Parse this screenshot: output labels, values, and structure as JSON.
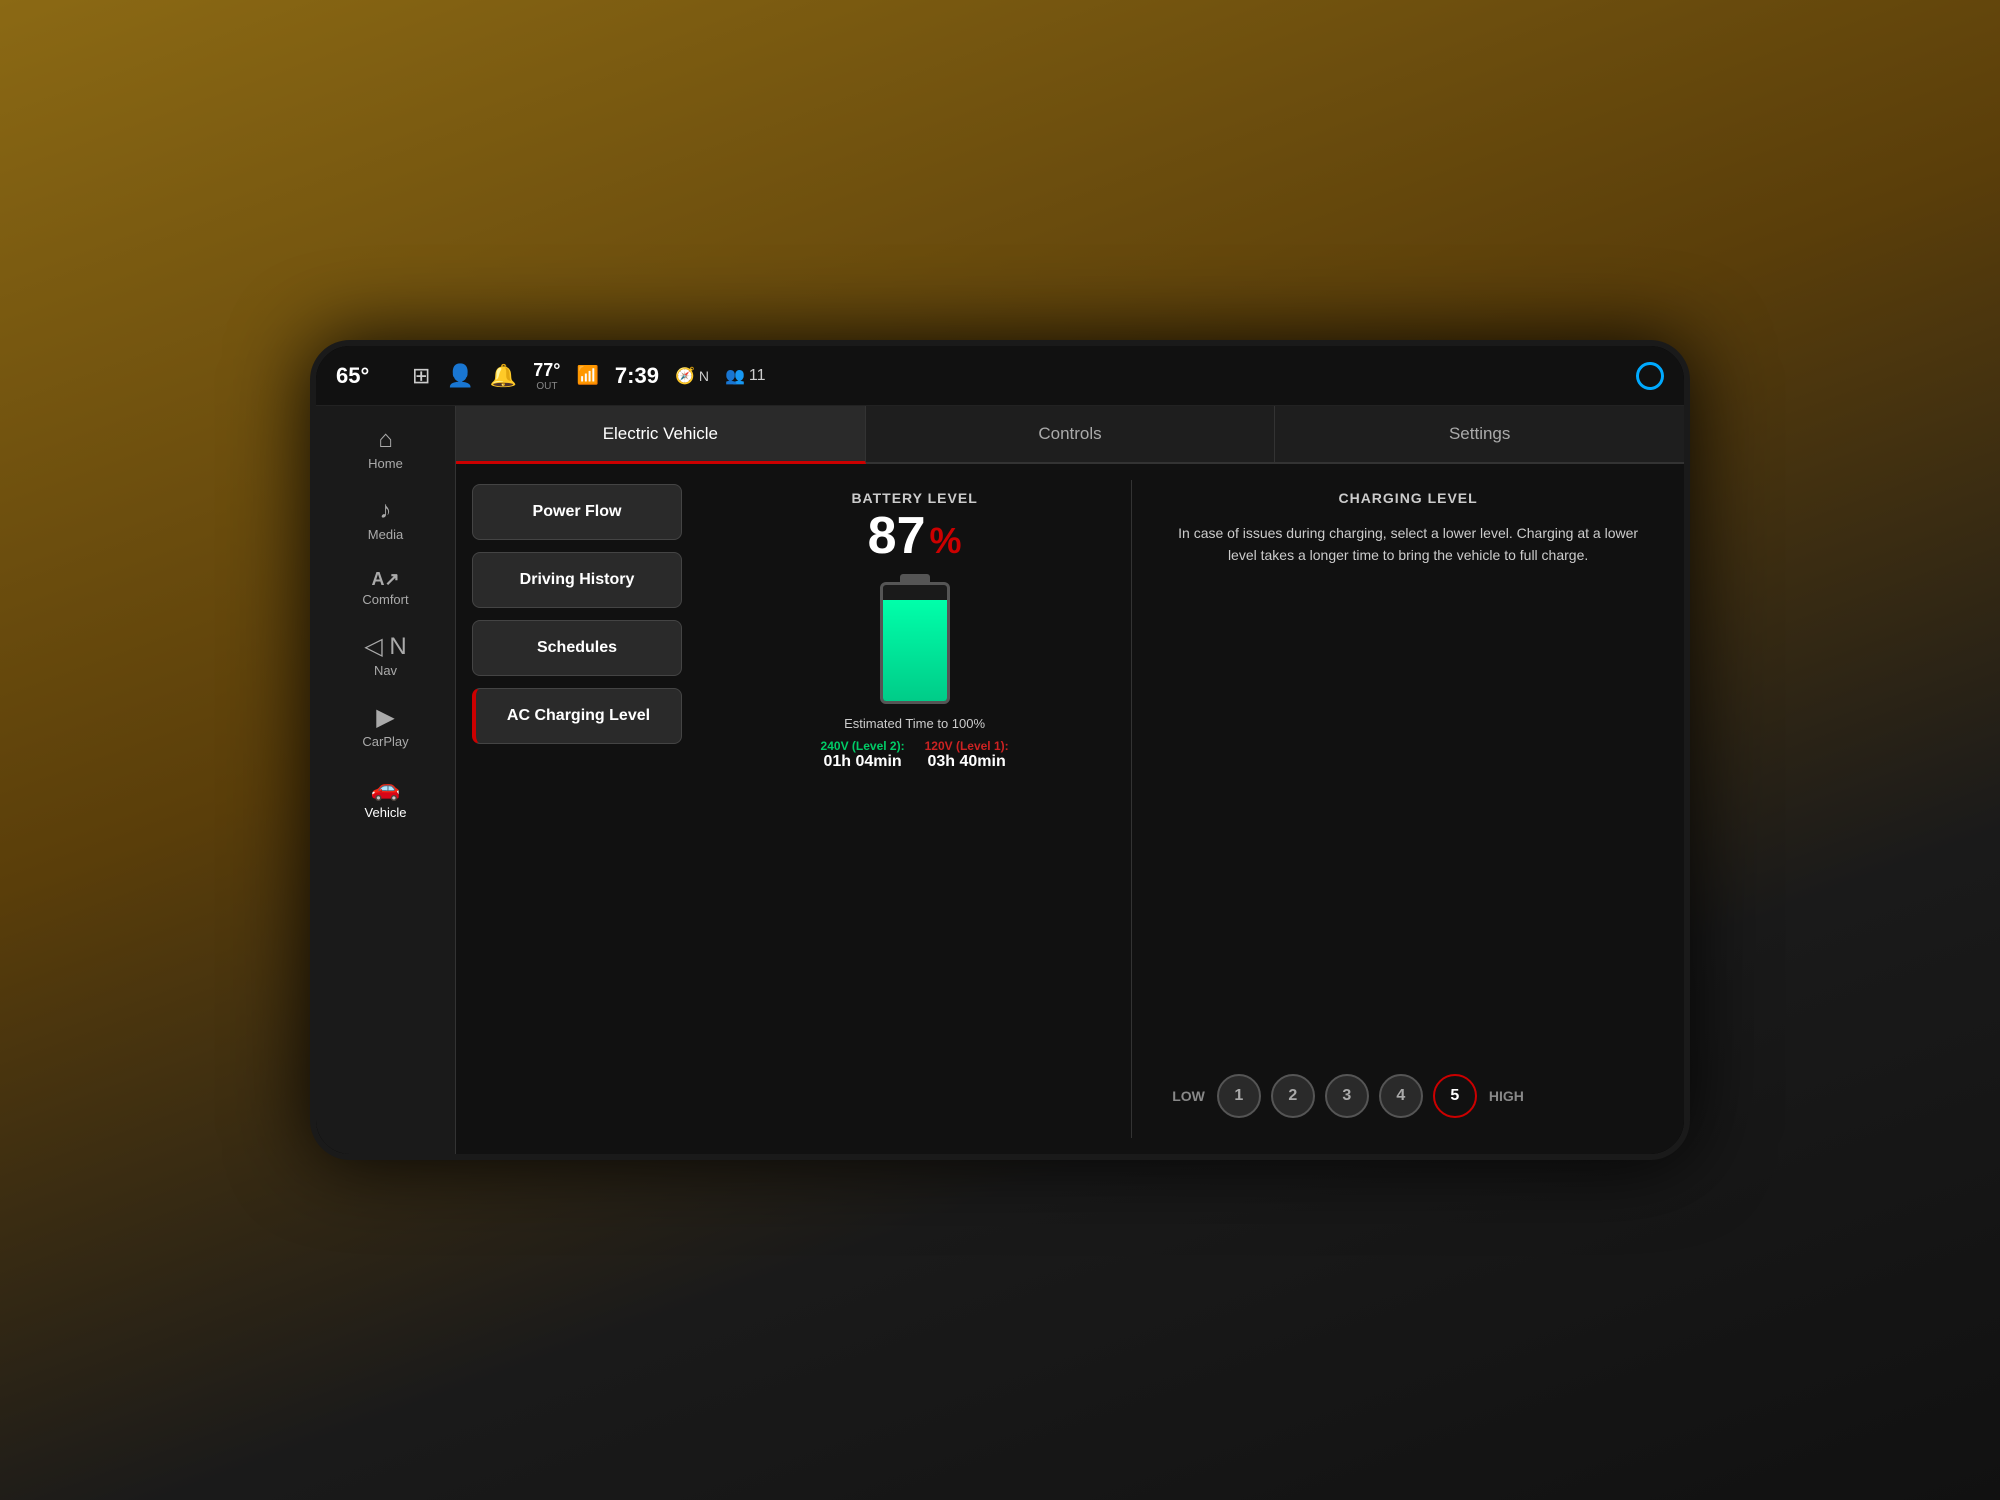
{
  "background": {
    "color": "#2a1a0a"
  },
  "status_bar": {
    "interior_temp": "65°",
    "grid_icon": "⊞",
    "profile_icon": "👤",
    "notification_icon": "🔔",
    "outside_temp": "77°",
    "outside_label": "OUT",
    "wifi_icon": "📶",
    "time": "7:39",
    "nav_dir": "N",
    "passengers": "11",
    "circle_indicator": ""
  },
  "sidebar": {
    "items": [
      {
        "id": "home",
        "icon": "⌂",
        "label": "Home",
        "active": false
      },
      {
        "id": "media",
        "icon": "♪",
        "label": "Media",
        "active": false
      },
      {
        "id": "comfort",
        "icon": "A",
        "label": "Comfort",
        "active": false
      },
      {
        "id": "nav",
        "icon": "◁",
        "label": "Nav",
        "active": false
      },
      {
        "id": "carplay",
        "icon": "▶",
        "label": "CarPlay",
        "active": false
      },
      {
        "id": "vehicle",
        "icon": "🚗",
        "label": "Vehicle",
        "active": true
      }
    ]
  },
  "tabs": [
    {
      "id": "electric-vehicle",
      "label": "Electric Vehicle",
      "active": true
    },
    {
      "id": "controls",
      "label": "Controls",
      "active": false
    },
    {
      "id": "settings",
      "label": "Settings",
      "active": false
    }
  ],
  "ev_buttons": [
    {
      "id": "power-flow",
      "label": "Power Flow",
      "active": false
    },
    {
      "id": "driving-history",
      "label": "Driving History",
      "active": false
    },
    {
      "id": "schedules",
      "label": "Schedules",
      "active": false
    },
    {
      "id": "ac-charging-level",
      "label": "AC Charging Level",
      "active": true
    }
  ],
  "battery": {
    "section_label": "BATTERY LEVEL",
    "percent": "87",
    "percent_symbol": "%",
    "fill_height": "87",
    "estimated_label": "Estimated Time to 100%",
    "level2": {
      "voltage_label": "240V (Level 2):",
      "time": "01h 04min"
    },
    "level1": {
      "voltage_label": "120V (Level 1):",
      "time": "03h 40min"
    }
  },
  "charging_level": {
    "title": "CHARGING LEVEL",
    "description": "In case of issues during charging, select a lower level. Charging at a lower level takes a longer time to bring the vehicle to full charge.",
    "low_label": "LOW",
    "high_label": "HIGH",
    "levels": [
      1,
      2,
      3,
      4,
      5
    ],
    "selected_level": 5
  }
}
